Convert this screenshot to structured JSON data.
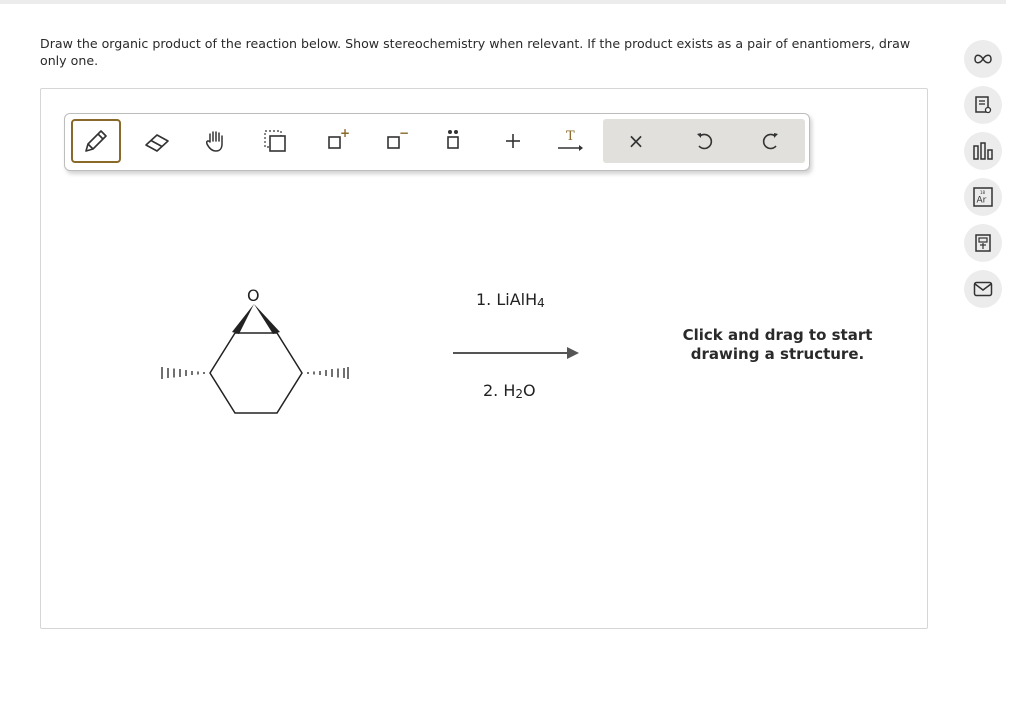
{
  "question": {
    "prompt": "Draw the organic product of the reaction below. Show stereochemistry when relevant. If the product exists as a pair of enantiomers, draw only one."
  },
  "toolbar": {
    "tools": [
      {
        "name": "pencil-icon",
        "selected": true
      },
      {
        "name": "eraser-icon"
      },
      {
        "name": "hand-icon"
      },
      {
        "name": "lasso-select-icon"
      },
      {
        "name": "positive-charge-icon"
      },
      {
        "name": "negative-charge-icon"
      },
      {
        "name": "lone-pair-icon"
      },
      {
        "name": "plus-icon"
      },
      {
        "name": "text-arrow-icon"
      },
      {
        "name": "close-icon"
      },
      {
        "name": "undo-icon"
      },
      {
        "name": "redo-icon"
      }
    ],
    "charge_plus": "+",
    "charge_minus": "−",
    "text_tool_letter": "T",
    "close_glyph": "×"
  },
  "reaction": {
    "atom_label": "O",
    "reagent1_prefix": "1. LiAlH",
    "reagent1_sub": "4",
    "reagent2_prefix": "2. H",
    "reagent2_sub": "2",
    "reagent2_suffix": "O"
  },
  "canvas": {
    "hint": "Click and drag to start drawing a structure."
  },
  "sidebar": {
    "buttons": [
      "infinity-icon",
      "notes-icon",
      "periodic-chart-icon",
      "periodic-element-icon",
      "calculator-icon",
      "mail-icon"
    ],
    "element_symbol": "Ar",
    "element_number": "18"
  },
  "colors": {
    "accent": "#8a6a2a",
    "tool_group_bg": "#e2e0dc",
    "side_button_bg": "#ececec"
  }
}
